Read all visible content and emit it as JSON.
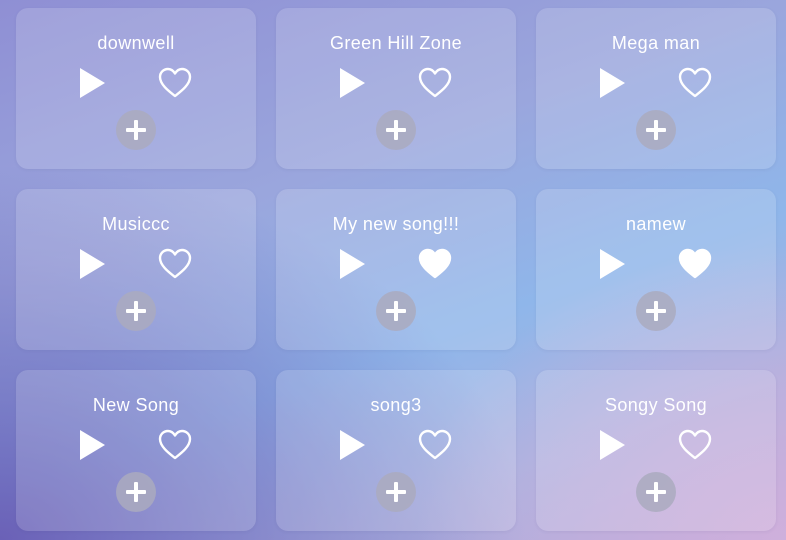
{
  "songs": [
    {
      "title": "downwell",
      "favorited": false
    },
    {
      "title": "Green Hill Zone",
      "favorited": false
    },
    {
      "title": "Mega man",
      "favorited": false
    },
    {
      "title": "Musiccc",
      "favorited": false
    },
    {
      "title": "My new song!!!",
      "favorited": true
    },
    {
      "title": "namew",
      "favorited": true
    },
    {
      "title": "New Song",
      "favorited": false
    },
    {
      "title": "song3",
      "favorited": false
    },
    {
      "title": "Songy Song",
      "favorited": false
    }
  ],
  "icons": {
    "play": "play-icon",
    "favorite_outline": "heart-outline-icon",
    "favorite_filled": "heart-filled-icon",
    "add": "plus-icon"
  },
  "colors": {
    "icon": "#ffffff",
    "add_button_bg": "#aaaabe"
  }
}
